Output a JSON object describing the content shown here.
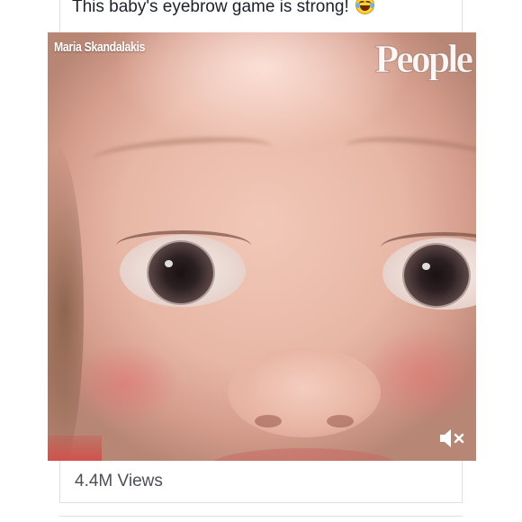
{
  "post": {
    "caption": "This baby's eyebrow game is strong!",
    "caption_emoji": "face-with-tears-of-joy",
    "views": "4.4M Views"
  },
  "video": {
    "creator_name": "Maria Skandalakis",
    "brand_logo": "People",
    "mute_icon": "speaker-muted-icon",
    "muted": true
  },
  "colors": {
    "border": "#dedfe2",
    "caption_text": "#1d2129",
    "meta_text": "#4b4f56",
    "overlay_text": "#ffffff"
  }
}
